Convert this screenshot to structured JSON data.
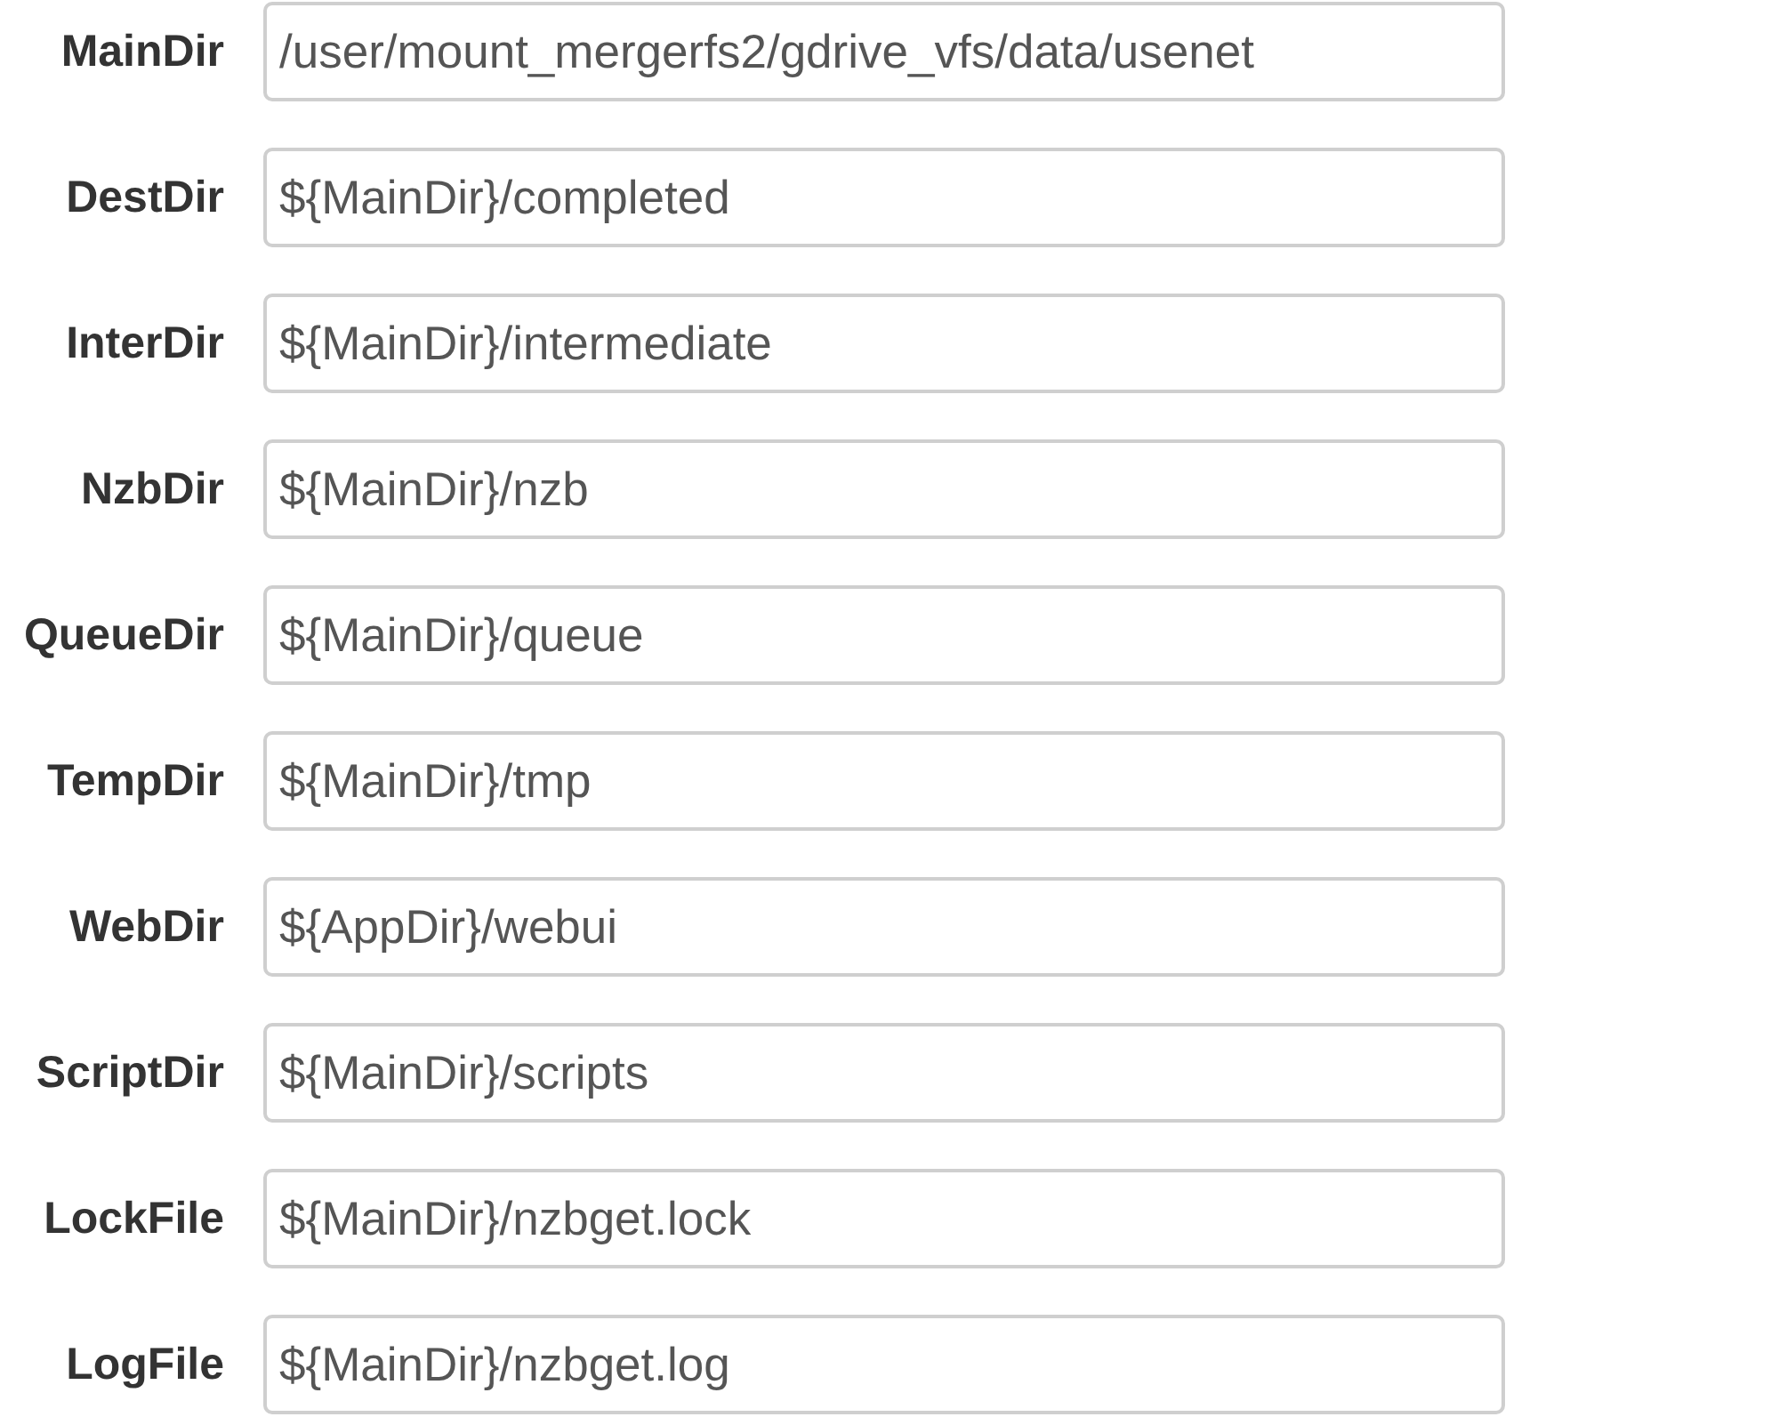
{
  "fields": [
    {
      "label": "MainDir",
      "value": "/user/mount_mergerfs2/gdrive_vfs/data/usenet"
    },
    {
      "label": "DestDir",
      "value": "${MainDir}/completed"
    },
    {
      "label": "InterDir",
      "value": "${MainDir}/intermediate"
    },
    {
      "label": "NzbDir",
      "value": "${MainDir}/nzb"
    },
    {
      "label": "QueueDir",
      "value": "${MainDir}/queue"
    },
    {
      "label": "TempDir",
      "value": "${MainDir}/tmp"
    },
    {
      "label": "WebDir",
      "value": "${AppDir}/webui"
    },
    {
      "label": "ScriptDir",
      "value": "${MainDir}/scripts"
    },
    {
      "label": "LockFile",
      "value": "${MainDir}/nzbget.lock"
    },
    {
      "label": "LogFile",
      "value": "${MainDir}/nzbget.log"
    }
  ]
}
